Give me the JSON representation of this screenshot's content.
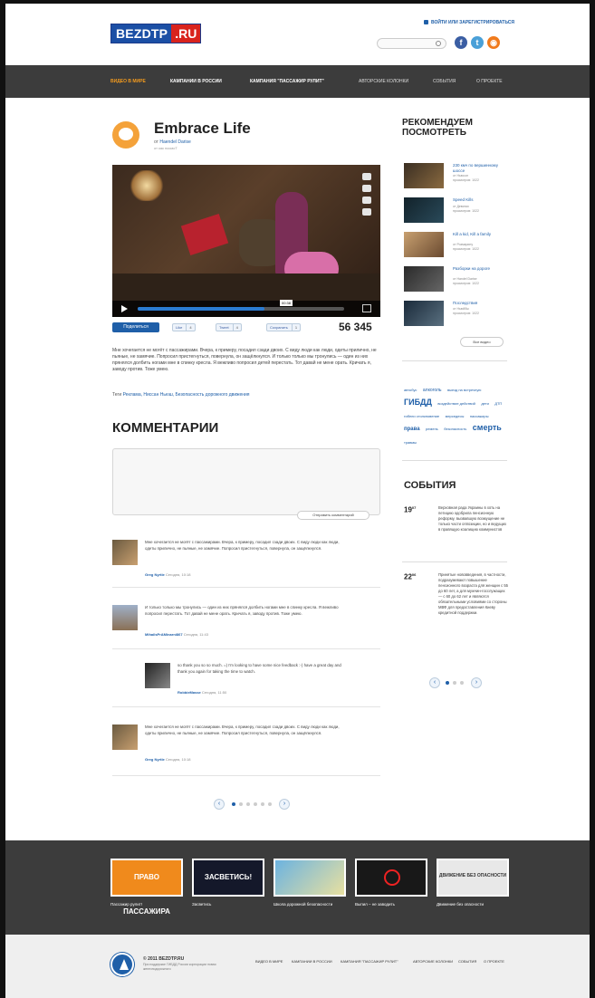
{
  "header": {
    "logo_part1": "BEZDTP",
    "logo_part2": ".RU",
    "login_text": "ВОЙТИ ИЛИ ЗАРЕГИСТРИРОВАТЬСЯ",
    "search_placeholder": "",
    "social": [
      "f",
      "t",
      "rss"
    ]
  },
  "nav": {
    "items": [
      {
        "label": "ВИДЕО В МИРЕ",
        "active": true
      },
      {
        "label": "КАМПАНИИ В РОССИИ"
      },
      {
        "label": "КАМПАНИЯ \"ПАССАЖИР РУЛИТ\""
      },
      {
        "label": "АВТОРСКИЕ КОЛОНКИ"
      },
      {
        "label": "СОБЫТИЯ"
      },
      {
        "label": "О ПРОЕКТЕ"
      }
    ]
  },
  "article": {
    "title": "Embrace Life",
    "author_prefix": "от",
    "author": "Haendel Darise",
    "subline": "от как посмоТ",
    "video_time": "00:38",
    "share_label": "Поделиться",
    "like_label": "Like",
    "like_count": "4",
    "tweet_label": "Tweet",
    "tweet_count": "4",
    "vk_label": "Сохранить",
    "vk_count": "1",
    "views": "56 345",
    "description": "Мне хочегается не могёт с пассажирами. Вчера, к примеру, посадил сзади двоих. С виду люди как люди, одеты прилично, не пьяные, не хамячие. Попросил пристегнуться, повернула, он защёлкнулся. И только только мы тронулись — один из них прянялся долбить ногами мне в спинку кресла. Я вежливо попросил детей перестать. Тот давай не мене орать. Кричать я, заводу против. Тоже умею.",
    "tags_prefix": "Теги",
    "tags": "Реклама, Ниссан Ньюш, Безопасность дорожного движения"
  },
  "comments": {
    "title": "КОММЕНТАРИИ",
    "send_label": "Отправить комментарий",
    "items": [
      {
        "text": "Мне хочегается не могёт с пассажирами. Вчера, к примеру, посадил сзади двоих. С виду люди как люди, одеты прилично, не пьяные, не хамячие. Попросил пристегнуться, повернула, он защёлкнулся.",
        "author": "Greg Nyrtle",
        "time": "Сегодня, 10:18"
      },
      {
        "text": "И только только мы тронулись — один из них прянялся долбить ногами мне в спинку кресла. Я вежливо попросил перестать. Тот давай не мене орать. Кричать я, заводу против. Тоже умею.",
        "author": "MihailsPrAMinarni867",
        "time": "Сегодня, 11:43"
      },
      {
        "text": "so thank you so so much. =) I'm looking to have some nice feedback :-) have a great day and thank you again for taking the time to watch.",
        "author": "RobbieMasse",
        "time": "Сегодня, 11:50"
      },
      {
        "text": "Мне хочегается не могёт с пассажирами. Вчера, к примеру, посадил сзади двоих. С виду люди как люди, одеты прилично, не пьяные, не хамячие. Попросил пристегнуться, повернула, он защёлкнулся.",
        "author": "Greg Nyrtle",
        "time": "Сегодня, 10:18"
      }
    ]
  },
  "sidebar": {
    "rec_title": "РЕКОМЕНДУЕМ ПОСМОТРЕТЬ",
    "rec_items": [
      {
        "title": "230 кмч по вершинному шоссе",
        "meta": "от Ньюсон\nпросмотров: 1022"
      },
      {
        "title": "Speed Kills",
        "meta": "от Девятки\nпросмотров: 1022"
      },
      {
        "title": "Kill a kid, Kill a family",
        "meta": "от Розмарину\nпросмотров: 1022"
      },
      {
        "title": "Разборки на дороге",
        "meta": "от Handel Darise\nпросмотров: 1022"
      },
      {
        "title": "Последствия",
        "meta": "от Ньюйбы\nпросмотров: 1022"
      }
    ],
    "all_videos": "Все видео",
    "cloud": [
      {
        "w": "автобус",
        "s": 4
      },
      {
        "w": "алкоголь",
        "s": 5
      },
      {
        "w": "выезд на встречную",
        "s": 4
      },
      {
        "w": "ГИБДД",
        "s": 9
      },
      {
        "w": "воздействие действий",
        "s": 4
      },
      {
        "w": "дети",
        "s": 4
      },
      {
        "w": "ДТП",
        "s": 4
      },
      {
        "w": "гибели столкновение",
        "s": 4
      },
      {
        "w": "мерседесы",
        "s": 4
      },
      {
        "w": "пассажиры",
        "s": 4
      },
      {
        "w": "права",
        "s": 6
      },
      {
        "w": "ремень",
        "s": 4
      },
      {
        "w": "безопасность",
        "s": 4
      },
      {
        "w": "смерть",
        "s": 9
      },
      {
        "w": "травмы",
        "s": 4
      }
    ],
    "events_title": "СОБЫТИЯ",
    "events": [
      {
        "day": "19",
        "month": "07",
        "text": "Верховная рада Украины в хоть на петицию одобрила пенсионную реформу, вызвавшую возмущение не только части оппозиции, но и ведущих в правящую коалицию коммунистов"
      },
      {
        "day": "22",
        "month": "06",
        "text": "Принятые нововведения, в частности, подразумевают повышение пенсионного возраста для женщин с 55 до 60 лет, а для мужчин-госслужащих — с 60 до 62 лет и являются обязательными условиями со стороны МВФ для предоставления Киеву кредитной поддержки."
      }
    ]
  },
  "footer": {
    "banners": [
      {
        "label": "ПРАВО ПАССАЖИРА",
        "caption": "Пассажир рулит!"
      },
      {
        "label": "ЗАСВЕТИСЬ!",
        "caption": "Засветись"
      },
      {
        "label": "",
        "caption": "Школа дорожной безопасности"
      },
      {
        "label": "",
        "caption": "Выпил – не заводить"
      },
      {
        "label": "ДВИЖЕНИЕ БЕЗ ОПАСНОСТИ",
        "caption": "Движение без опасности"
      }
    ],
    "copyright": "© 2011 BEZDTP.RU",
    "copyright_sub": "При поддержке ГИБДД России корпорации новая железнодорожного",
    "nav": [
      "ВИДЕО В МИРЕ",
      "КАМПАНИИ В РОССИИ",
      "КАМПАНИЯ \"ПАССАЖИР РУЛИТ\"",
      "АВТОРСКИЕ КОЛОНКИ",
      "СОБЫТИЯ",
      "О ПРОЕКТЕ"
    ]
  }
}
